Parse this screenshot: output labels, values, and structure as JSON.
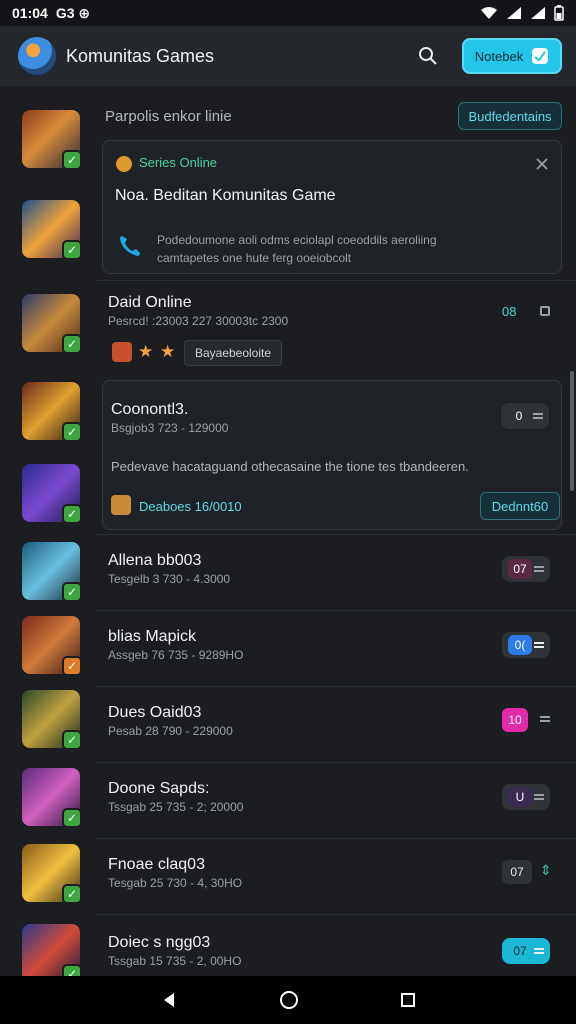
{
  "status": {
    "time": "01:04",
    "carrier": "G3 ⊕"
  },
  "appbar": {
    "title": "Komunitas Games",
    "notif_label": "Notebek"
  },
  "section": {
    "heading": "Parpolis enkor linie",
    "button": "Budfedentains"
  },
  "card1": {
    "tag": "Series Online",
    "title": "Noa. Beditan Komunitas Game",
    "body_line1": "Podedoumone aoli odms eciolapl coeoddils aeroliing",
    "body_line2": "camtapetes one hute ferg ooeiobcolt"
  },
  "row1": {
    "title": "Daid Online",
    "subtitle": "Pesrcd! :23003 227 30003tc 2300",
    "tag": "Bayaebeoloite",
    "toggle": "08"
  },
  "card2": {
    "title": "Coonontl3.",
    "subtitle": "Bsgjob3 723 - 129000",
    "body": "Pedevave hacataguand othecasaine the tione tes tbandeeren.",
    "footer": "Deaboes 16/0010",
    "button": "Dednnt60",
    "toggle": "0"
  },
  "rows": [
    {
      "title": "Allena bb003",
      "subtitle": "Tesgelb 3 730 - 4.3000",
      "toggle": "07",
      "accent": "#5a2a44"
    },
    {
      "title": "blias Mapick",
      "subtitle": "Assgeb 76 735 - 9289HO",
      "toggle": "0(",
      "accent": "#2b7be8"
    },
    {
      "title": "Dues Oaid03",
      "subtitle": "Pesab 28 790 - 229000",
      "toggle": "10",
      "accent": "#e22aa8"
    },
    {
      "title": "Doone Sapds:",
      "subtitle": "Tssgab 25 735 - 2; 20000",
      "toggle": "U",
      "accent": "#3b2a52"
    },
    {
      "title": "Fnoae claq03",
      "subtitle": "Tesgab 25 730 - 4, 30HO",
      "toggle": "07",
      "accent": "#2f3338"
    },
    {
      "title": "Doiec s ngg03",
      "subtitle": "Tssgab 15 735 - 2, 00HO",
      "toggle": "07",
      "accent": "#1bb8d6"
    }
  ],
  "colors": {
    "accent": "#23c6e8",
    "bg": "#1b1d21",
    "card": "#1f2226"
  }
}
